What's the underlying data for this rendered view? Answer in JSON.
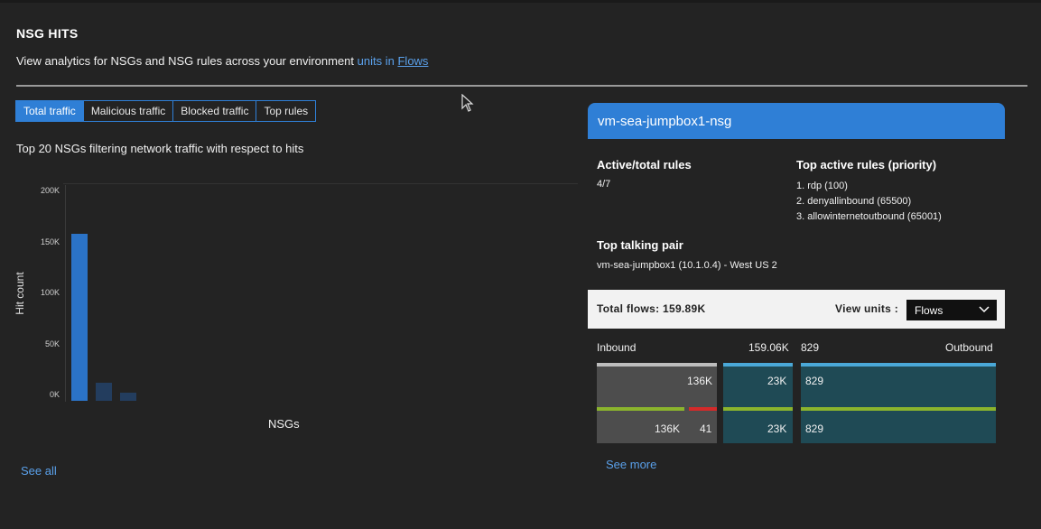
{
  "header": {
    "title": "NSG HITS",
    "subtitle": "View analytics for NSGs and NSG rules across your environment",
    "subtitle_units": "units in",
    "subtitle_link": "Flows"
  },
  "tabs": [
    {
      "label": "Total traffic",
      "active": true
    },
    {
      "label": "Malicious traffic",
      "active": false
    },
    {
      "label": "Blocked traffic",
      "active": false
    },
    {
      "label": "Top rules",
      "active": false
    }
  ],
  "chart_title": "Top 20 NSGs filtering network traffic with respect to hits",
  "chart_data": {
    "type": "bar",
    "xlabel": "NSGs",
    "ylabel": "Hit count",
    "ylim": [
      0,
      200000
    ],
    "yticks": [
      "200K",
      "150K",
      "100K",
      "50K",
      "0K"
    ],
    "values": [
      159890,
      17000,
      8000
    ],
    "colors": [
      "#2b73c7",
      "#233d5e",
      "#233d5e"
    ]
  },
  "see_all": "See all",
  "details": {
    "nsg_name": "vm-sea-jumpbox1-nsg",
    "active_rules_label": "Active/total rules",
    "active_rules_value": "4/7",
    "top_rules_label": "Top active rules (priority)",
    "top_rules": [
      "1. rdp (100)",
      "2. denyallinbound (65500)",
      "3. allowinternetoutbound (65001)"
    ],
    "talking_pair_label": "Top talking pair",
    "talking_pair_value": "vm-sea-jumpbox1 (10.1.0.4) - West US 2",
    "total_flows": "Total flows: 159.89K",
    "view_units_label": "View units :",
    "view_units_value": "Flows"
  },
  "flows": {
    "inbound_label": "Inbound",
    "inbound_total": "159.06K",
    "outbound_total": "829",
    "outbound_label": "Outbound",
    "col1_top": "136K",
    "col1_bottom_allowed": "136K",
    "col1_bottom_denied": "41",
    "col2_top": "23K",
    "col2_bottom": "23K",
    "col3_top": "829",
    "col3_bottom": "829"
  },
  "see_more": "See more",
  "colors": {
    "accent": "#2f7fd6",
    "link": "#5aa0ea",
    "allowed": "#8bb42d",
    "denied": "#d42a2a",
    "teal_stripe": "#4aa8d8"
  }
}
